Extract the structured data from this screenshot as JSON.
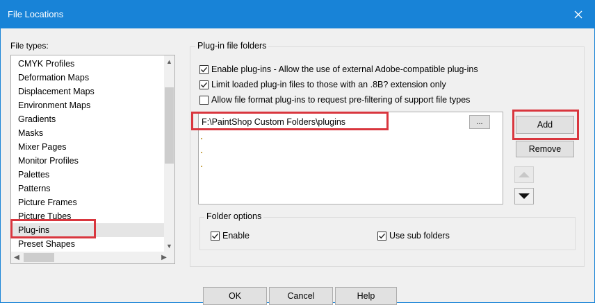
{
  "window": {
    "title": "File Locations"
  },
  "file_types": {
    "label": "File types:",
    "items": [
      "CMYK Profiles",
      "Deformation Maps",
      "Displacement Maps",
      "Environment Maps",
      "Gradients",
      "Masks",
      "Mixer Pages",
      "Monitor Profiles",
      "Palettes",
      "Patterns",
      "Picture Frames",
      "Picture Tubes",
      "Plug-ins",
      "Preset Shapes"
    ],
    "selected": "Plug-ins"
  },
  "plugin_folders": {
    "group_label": "Plug-in file folders",
    "options": [
      {
        "label": "Enable plug-ins - Allow the use of external Adobe-compatible plug-ins",
        "checked": true
      },
      {
        "label": "Limit loaded plug-in files to those with an .8B? extension only",
        "checked": true
      },
      {
        "label": "Allow file format plug-ins to request pre-filtering of support file types",
        "checked": false
      }
    ],
    "folder_path": "F:\\PaintShop Custom Folders\\plugins",
    "browse_label": "...",
    "add_label": "Add",
    "remove_label": "Remove"
  },
  "folder_options": {
    "group_label": "Folder options",
    "enable": {
      "label": "Enable",
      "checked": true
    },
    "subfolders": {
      "label": "Use sub folders",
      "checked": true
    }
  },
  "footer": {
    "ok": "OK",
    "cancel": "Cancel",
    "help": "Help"
  },
  "colors": {
    "title_bar": "#1883d7",
    "highlight": "#d9363e"
  }
}
